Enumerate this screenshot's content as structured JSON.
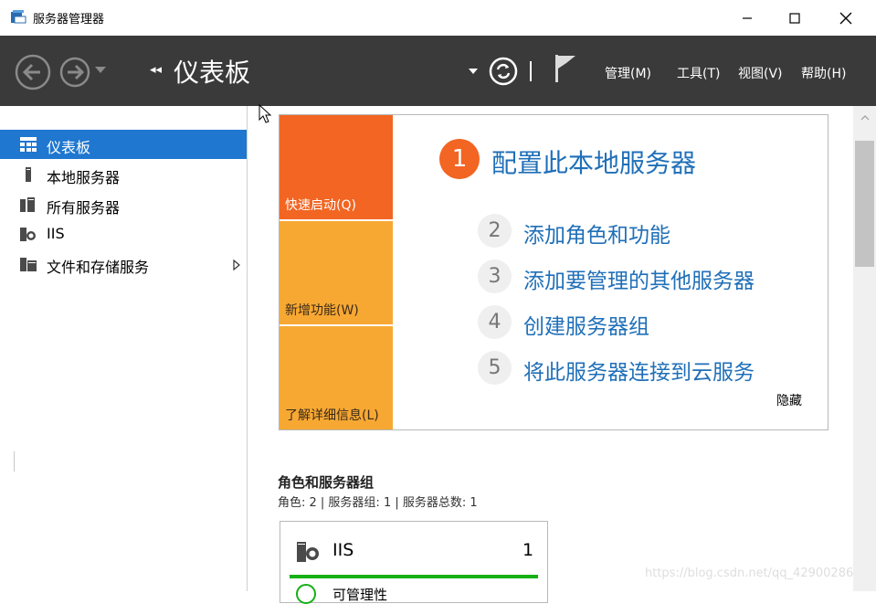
{
  "window": {
    "title": "服务器管理器"
  },
  "header": {
    "breadcrumb_arrows": "◂◂",
    "title": "仪表板",
    "menu": [
      "管理(M)",
      "工具(T)",
      "视图(V)",
      "帮助(H)"
    ]
  },
  "sidebar": {
    "items": [
      {
        "label": "仪表板",
        "icon": "dashboard-icon",
        "active": true
      },
      {
        "label": "本地服务器",
        "icon": "server-icon"
      },
      {
        "label": "所有服务器",
        "icon": "servers-icon"
      },
      {
        "label": "IIS",
        "icon": "iis-icon"
      },
      {
        "label": "文件和存储服务",
        "icon": "storage-icon",
        "expandable": true
      }
    ]
  },
  "quick_start": {
    "tiles": [
      "快速启动(Q)",
      "新增功能(W)",
      "了解详细信息(L)"
    ],
    "step1": {
      "number": "1",
      "text": "配置此本地服务器"
    },
    "steps": [
      {
        "number": "2",
        "text": "添加角色和功能"
      },
      {
        "number": "3",
        "text": "添加要管理的其他服务器"
      },
      {
        "number": "4",
        "text": "创建服务器组"
      },
      {
        "number": "5",
        "text": "将此服务器连接到云服务"
      }
    ],
    "hide_label": "隐藏"
  },
  "roles": {
    "title": "角色和服务器组",
    "summary": "角色: 2 | 服务器组: 1 | 服务器总数: 1",
    "card": {
      "name": "IIS",
      "count": "1",
      "status": "可管理性"
    }
  },
  "watermark": "https://blog.csdn.net/qq_42900286",
  "colors": {
    "accent": "#1f77d0",
    "quick_start": "#f26522",
    "tile": "#f7a833",
    "link": "#1f6fb8",
    "ok": "#16b016",
    "header": "#3a3a3a"
  }
}
